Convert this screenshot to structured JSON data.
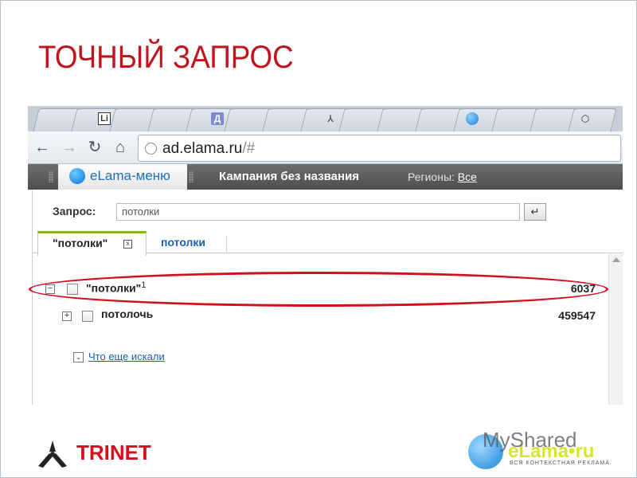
{
  "slide": {
    "title": "ТОЧНЫЙ ЗАПРОС",
    "logo_left_text": "TRINET",
    "logo_right_wordmark": "eLama•ru",
    "logo_right_tagline": "ВСЯ КОНТЕКСТНАЯ РЕКЛАМА",
    "watermark": "MyShared"
  },
  "browser": {
    "tabs": [
      {
        "icon": "li-icon",
        "glyph": "Li"
      },
      {
        "icon": "d-icon",
        "glyph": "Д"
      },
      {
        "icon": "tripod-icon",
        "glyph": "⅄"
      },
      {
        "icon": "globe-icon",
        "glyph": ""
      },
      {
        "icon": "cube-icon",
        "glyph": "⬡"
      }
    ],
    "address": "ad.elama.ru",
    "address_path": "/#",
    "nav": {
      "back": "←",
      "forward": "→",
      "reload": "↻",
      "home": "⌂"
    }
  },
  "elama_bar": {
    "menu_label": "eLama-меню",
    "campaign": "Кампания без названия",
    "regions_label": "Регионы: ",
    "regions_value": "Все"
  },
  "query": {
    "label": "Запрос:",
    "value": "потолки",
    "enter_glyph": "↵"
  },
  "subtabs": [
    {
      "label": "\"потолки\"",
      "active": true,
      "close": "x"
    },
    {
      "label": "потолки",
      "active": false
    }
  ],
  "rows": [
    {
      "toggle": "−",
      "label": "\"потолки\"",
      "sup": "1",
      "count": "6037"
    },
    {
      "toggle": "+",
      "label": "потолочь",
      "sup": "",
      "count": "459547"
    }
  ],
  "more": {
    "toggle": "⌄",
    "label": "Что еще искали"
  },
  "colors": {
    "title": "#c0151c",
    "highlight": "#d40f1a",
    "link": "#1a5fb0",
    "active_tab_accent": "#7fb433"
  }
}
